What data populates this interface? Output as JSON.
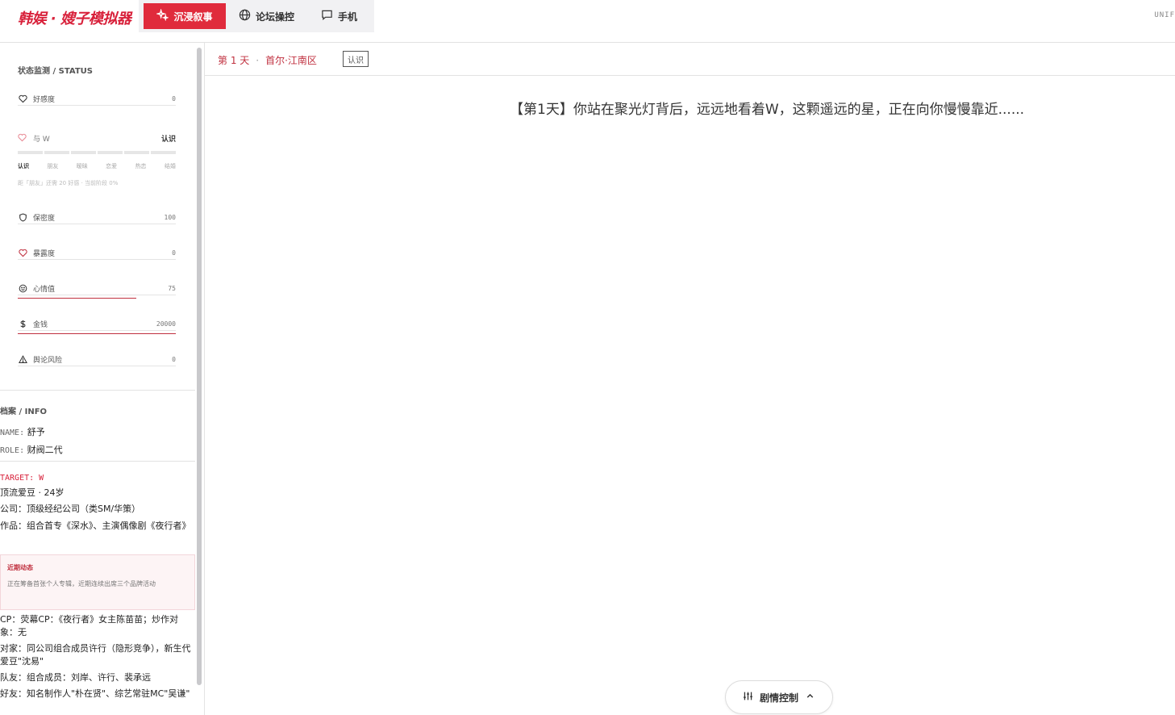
{
  "app": {
    "title": "韩娱 · 嫂子模拟器",
    "corner": "UNIF"
  },
  "nav": {
    "items": [
      {
        "label": "沉浸叙事",
        "icon": "sparkle-icon"
      },
      {
        "label": "论坛操控",
        "icon": "globe-icon"
      },
      {
        "label": "手机",
        "icon": "chat-icon"
      }
    ]
  },
  "status": {
    "title": "状态监测 / STATUS",
    "favor": {
      "label": "好感度",
      "value": "0"
    },
    "relation": {
      "label": "与 W",
      "value": "认识",
      "steps": [
        "认识",
        "朋友",
        "暧昧",
        "恋爱",
        "热恋",
        "结婚"
      ],
      "current_index": 0,
      "hint": "距「朋友」还需 20 好感 · 当前阶段 0%"
    },
    "secrecy": {
      "label": "保密度",
      "value": "100"
    },
    "exposure": {
      "label": "暴露度",
      "value": "0"
    },
    "mood": {
      "label": "心情值",
      "value": "75",
      "fraction": 0.75
    },
    "money": {
      "label": "金钱",
      "value": "20000",
      "fraction": 1.0
    },
    "risk": {
      "label": "舆论风险",
      "value": "0"
    }
  },
  "info": {
    "title": "档案 / INFO",
    "name_key": "NAME:",
    "name": "舒予",
    "role_key": "ROLE:",
    "role": "财阀二代",
    "target": "TARGET: W",
    "t_line1": "顶流爱豆 · 24岁",
    "t_line2": "公司：顶级经纪公司（类SM/华策）",
    "t_line3": "作品：组合首专《深水》、主演偶像剧《夜行者》",
    "recent_title": "近期动态",
    "recent_body": "正在筹备首张个人专辑，近期连续出席三个品牌活动",
    "t_line4": "CP：荧幕CP：《夜行者》女主陈苗苗；炒作对象：无",
    "t_line5": "对家：同公司组合成员许行（隐形竞争），新生代爱豆\"沈易\"",
    "t_line6": "队友：组合成员：刘岸、许行、裴承远",
    "t_line7": "好友：知名制作人\"朴在贤\"、综艺常驻MC\"吴谦\""
  },
  "main": {
    "day": "第 1 天",
    "sep": "·",
    "location": "首尔·江南区",
    "badge": "认识",
    "story": "【第1天】你站在聚光灯背后，远远地看着W，这颗遥远的星，正在向你慢慢靠近......",
    "plot_button": "剧情控制"
  },
  "colors": {
    "accent": "#e02b3c",
    "brand": "#d8203a"
  }
}
